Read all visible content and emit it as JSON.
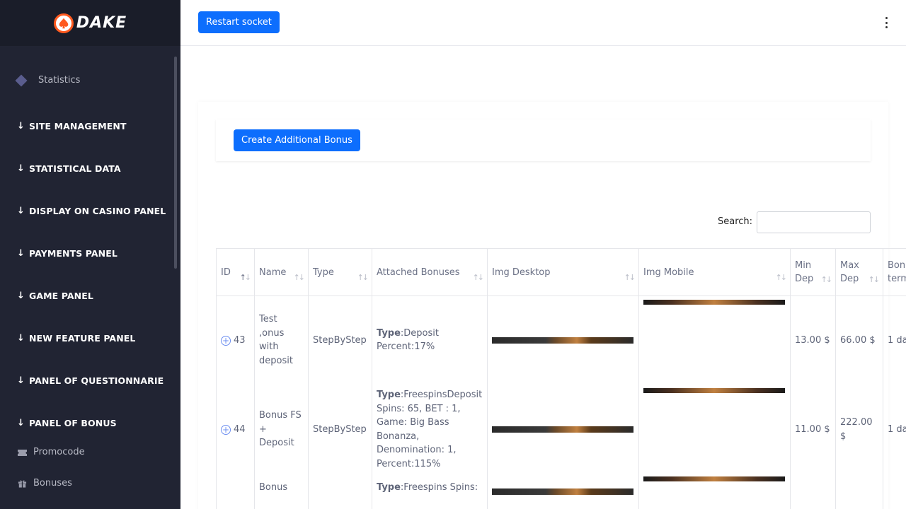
{
  "brand": {
    "name": "DAKE"
  },
  "sidebar": {
    "statistics": "Statistics",
    "sections": [
      "SITE MANAGEMENT",
      "STATISTICAL DATA",
      "DISPLAY ON CASINO PANEL",
      "PAYMENTS PANEL",
      "GAME PANEL",
      "NEW FEATURE PANEL",
      "PANEL OF QUESTIONNARIE",
      "PANEL OF BONUS"
    ],
    "sub_items": [
      "Promocode",
      "Bonuses"
    ]
  },
  "topbar": {
    "restart_label": "Restart socket"
  },
  "page": {
    "create_label": "Create Additional Bonus",
    "search_label": "Search:",
    "search_value": ""
  },
  "table": {
    "headers": [
      "ID",
      "Name",
      "Type",
      "Attached Bonuses",
      "Img Desktop",
      "Img Mobile",
      "Min Dep",
      "Max Dep",
      "Bonus term"
    ],
    "rows": [
      {
        "id": "43",
        "name": "Test ,onus with deposit",
        "type": "StepByStep",
        "attached_type_key": "Type",
        "attached_type": ":Deposit",
        "attached_rest": "Percent:17%",
        "min_dep": "13.00 $",
        "max_dep": "66.00 $",
        "term": "1 da"
      },
      {
        "id": "44",
        "name": "Bonus FS + Deposit",
        "type": "StepByStep",
        "attached_type_key": "Type",
        "attached_type": ":FreespinsDeposit",
        "attached_rest": "Spins: 65, BET : 1, Game: Big Bass Bonanza, Denomination: 1, Percent:115%",
        "min_dep": "11.00 $",
        "max_dep": "222.00 $",
        "term": "1 da"
      },
      {
        "id": "",
        "name": "Bonus",
        "type": "",
        "attached_type_key": "Type",
        "attached_type": ":Freespins Spins:",
        "attached_rest": "",
        "min_dep": "",
        "max_dep": "",
        "term": ""
      }
    ]
  }
}
